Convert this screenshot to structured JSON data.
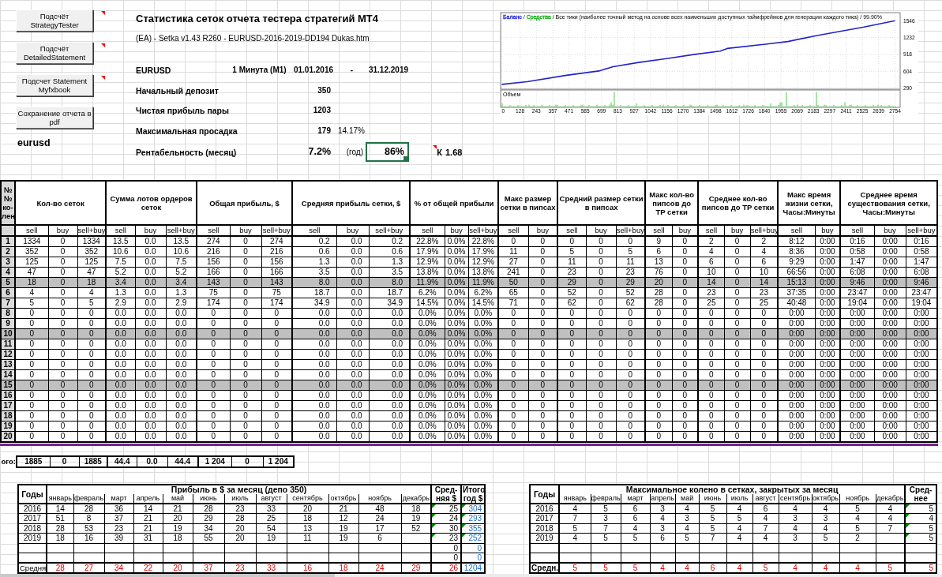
{
  "toolbar_buttons": [
    {
      "label": "Подсчёт StrategyTester",
      "has_comment": true
    },
    {
      "label": "Подсчёт DetailedStatement",
      "has_comment": true
    },
    {
      "label": "Подсчет Statement Myfxbook",
      "has_comment": true
    },
    {
      "label": "Сохранение отчета в pdf",
      "has_comment": false
    }
  ],
  "pair_cell": "eurusd",
  "report": {
    "title": "Статистика сеток отчета тестера стратегий МТ4",
    "file": "(EA) - Setka v1.43 R260 - EURUSD-2016-2019-DD194 Dukas.htm",
    "symbol": "EURUSD",
    "timeframe": "1 Минута (M1)",
    "date_from": "01.01.2016",
    "date_separator": "-",
    "date_to": "31.12.2019",
    "metrics": [
      {
        "label": "Начальный депозит",
        "value": "350"
      },
      {
        "label": "Чистая прибыль пары",
        "value": "1203"
      },
      {
        "label": "Максимальная просадка",
        "value": "179",
        "extra": "14.17%"
      }
    ],
    "profitability": {
      "label": "Рентабельность (месяц)",
      "value": "7.2%",
      "year_label": "(год)",
      "year_value": "86%",
      "year_selected": true,
      "ratio_label": "К",
      "ratio_comment": true,
      "ratio_value": "1.68"
    }
  },
  "chart": {
    "header": [
      {
        "text": "Баланс",
        "color": "#3535e0"
      },
      {
        "text": "/"
      },
      {
        "text": "Средства",
        "color": "#22b022"
      },
      {
        "text": "/ Все тики (наиболее точный метод на основе всех наименьших доступных таймфреймов для генерации каждого тика) / 99.90%"
      }
    ],
    "volume_label": "Объем",
    "chart_data": {
      "type": "line",
      "x": [
        0,
        178,
        454,
        681,
        780,
        958,
        1155,
        1352,
        1530,
        1579,
        1846,
        2004,
        2201,
        2537,
        2754
      ],
      "series": [
        {
          "color": "#2323c8",
          "values": [
            360,
            410,
            530,
            610,
            690,
            770,
            840,
            920,
            980,
            1030,
            1110,
            1160,
            1270,
            1430,
            1550
          ]
        }
      ],
      "xlim": [
        0,
        2790
      ],
      "ylim": [
        270,
        1700
      ],
      "xticks": [
        0,
        128,
        243,
        357,
        471,
        585,
        699,
        813,
        927,
        1042,
        1156,
        1270,
        1384,
        1498,
        1612,
        1726,
        1840,
        1955,
        2069,
        2183,
        2297,
        2411,
        2525,
        2639,
        2754
      ],
      "yticks": [
        290,
        604,
        918,
        1232,
        1546
      ],
      "grid": true
    }
  },
  "grid_table": {
    "corner": "№ № ко-лен",
    "groups": [
      {
        "title": "Кол-во сеток",
        "columns": [
          "sell",
          "buy",
          "sell+buy"
        ]
      },
      {
        "title": "Сумма лотов ордеров сеток",
        "columns": [
          "sell",
          "buy",
          "sell+buy"
        ]
      },
      {
        "title": "Общая прибыль, $",
        "columns": [
          "sell",
          "buy",
          "sell+buy"
        ]
      },
      {
        "title": "Средняя прибыль сетки, $",
        "columns": [
          "sell",
          "buy",
          "sell+buy"
        ]
      },
      {
        "title": "% от общей прибыли",
        "columns": [
          "sell",
          "buy",
          "sell+buy"
        ]
      },
      {
        "title": "Макс размер сетки в пипсах",
        "columns": [
          "sell",
          "buy"
        ]
      },
      {
        "title": "Средний размер сетки в пипсах",
        "columns": [
          "sell",
          "buy",
          "sell+buy"
        ]
      },
      {
        "title": "Макс кол-во пипсов до TP сетки",
        "columns": [
          "sell",
          "buy"
        ]
      },
      {
        "title": "Среднее кол-во пипсов до TP сетки",
        "columns": [
          "sell",
          "buy",
          "sell+buy"
        ]
      },
      {
        "title": "Макс время жизни сетки, Часы:Минуты",
        "columns": [
          "sell",
          "buy"
        ]
      },
      {
        "title": "Среднее время существования сетки, Часы:Минуты",
        "columns": [
          "sell",
          "buy",
          "sell+buy"
        ]
      }
    ],
    "rows": [
      {
        "number": "1",
        "shaded": false,
        "cells": [
          "1334",
          "0",
          "1334",
          "13.5",
          "0.0",
          "13.5",
          "274",
          "0",
          "274",
          "0.2",
          "0.0",
          "0.2",
          "22.8%",
          "0.0%",
          "22.8%",
          "0",
          "0",
          "0",
          "0",
          "0",
          "9",
          "0",
          "2",
          "0",
          "2",
          "8:12",
          "0:00",
          "0:16",
          "0:00",
          "0:16"
        ]
      },
      {
        "number": "2",
        "shaded": false,
        "cells": [
          "352",
          "0",
          "352",
          "10.6",
          "0.0",
          "10.6",
          "216",
          "0",
          "216",
          "0.6",
          "0.0",
          "0.6",
          "17.9%",
          "0.0%",
          "17.9%",
          "11",
          "0",
          "5",
          "0",
          "5",
          "6",
          "0",
          "4",
          "0",
          "4",
          "8:36",
          "0:00",
          "0:58",
          "0:00",
          "0:58"
        ]
      },
      {
        "number": "3",
        "shaded": false,
        "cells": [
          "125",
          "0",
          "125",
          "7.5",
          "0.0",
          "7.5",
          "156",
          "0",
          "156",
          "1.3",
          "0.0",
          "1.3",
          "12.9%",
          "0.0%",
          "12.9%",
          "27",
          "0",
          "11",
          "0",
          "11",
          "13",
          "0",
          "6",
          "0",
          "6",
          "9:29",
          "0:00",
          "1:47",
          "0:00",
          "1:47"
        ]
      },
      {
        "number": "4",
        "shaded": false,
        "cells": [
          "47",
          "0",
          "47",
          "5.2",
          "0.0",
          "5.2",
          "166",
          "0",
          "166",
          "3.5",
          "0.0",
          "3.5",
          "13.8%",
          "0.0%",
          "13.8%",
          "241",
          "0",
          "23",
          "0",
          "23",
          "76",
          "0",
          "10",
          "0",
          "10",
          "66:56",
          "0:00",
          "6:08",
          "0:00",
          "6:08"
        ]
      },
      {
        "number": "5",
        "shaded": true,
        "cells": [
          "18",
          "0",
          "18",
          "3.4",
          "0.0",
          "3.4",
          "143",
          "0",
          "143",
          "8.0",
          "0.0",
          "8.0",
          "11.9%",
          "0.0%",
          "11.9%",
          "50",
          "0",
          "29",
          "0",
          "29",
          "20",
          "0",
          "14",
          "0",
          "14",
          "15:13",
          "0:00",
          "9:46",
          "0:00",
          "9:46"
        ]
      },
      {
        "number": "6",
        "shaded": false,
        "cells": [
          "4",
          "0",
          "4",
          "1.3",
          "0.0",
          "1.3",
          "75",
          "0",
          "75",
          "18.7",
          "0.0",
          "18.7",
          "6.2%",
          "0.0%",
          "6.2%",
          "65",
          "0",
          "52",
          "0",
          "52",
          "28",
          "0",
          "23",
          "0",
          "23",
          "37:35",
          "0:00",
          "23:47",
          "0:00",
          "23:47"
        ]
      },
      {
        "number": "7",
        "shaded": false,
        "cells": [
          "5",
          "0",
          "5",
          "2.9",
          "0.0",
          "2.9",
          "174",
          "0",
          "174",
          "34.9",
          "0.0",
          "34.9",
          "14.5%",
          "0.0%",
          "14.5%",
          "71",
          "0",
          "62",
          "0",
          "62",
          "28",
          "0",
          "25",
          "0",
          "25",
          "40:48",
          "0:00",
          "19:04",
          "0:00",
          "19:04"
        ]
      },
      {
        "number": "8",
        "shaded": false,
        "cells": [
          "0",
          "0",
          "0",
          "0.0",
          "0.0",
          "0.0",
          "0",
          "0",
          "0",
          "0.0",
          "0.0",
          "0.0",
          "0.0%",
          "0.0%",
          "0.0%",
          "0",
          "0",
          "0",
          "0",
          "0",
          "0",
          "0",
          "0",
          "0",
          "0",
          "0:00",
          "0:00",
          "0:00",
          "0:00",
          "0:00"
        ]
      },
      {
        "number": "9",
        "shaded": false,
        "cells": [
          "0",
          "0",
          "0",
          "0.0",
          "0.0",
          "0.0",
          "0",
          "0",
          "0",
          "0.0",
          "0.0",
          "0.0",
          "0.0%",
          "0.0%",
          "0.0%",
          "0",
          "0",
          "0",
          "0",
          "0",
          "0",
          "0",
          "0",
          "0",
          "0",
          "0:00",
          "0:00",
          "0:00",
          "0:00",
          "0:00"
        ]
      },
      {
        "number": "10",
        "shaded": true,
        "cells": [
          "0",
          "0",
          "0",
          "0.0",
          "0.0",
          "0.0",
          "0",
          "0",
          "0",
          "0.0",
          "0.0",
          "0.0",
          "0.0%",
          "0.0%",
          "0.0%",
          "0",
          "0",
          "0",
          "0",
          "0",
          "0",
          "0",
          "0",
          "0",
          "0",
          "0:00",
          "0:00",
          "0:00",
          "0:00",
          "0:00"
        ]
      },
      {
        "number": "11",
        "shaded": false,
        "cells": [
          "0",
          "0",
          "0",
          "0.0",
          "0.0",
          "0.0",
          "0",
          "0",
          "0",
          "0.0",
          "0.0",
          "0.0",
          "0.0%",
          "0.0%",
          "0.0%",
          "0",
          "0",
          "0",
          "0",
          "0",
          "0",
          "0",
          "0",
          "0",
          "0",
          "0:00",
          "0:00",
          "0:00",
          "0:00",
          "0:00"
        ]
      },
      {
        "number": "12",
        "shaded": false,
        "cells": [
          "0",
          "0",
          "0",
          "0.0",
          "0.0",
          "0.0",
          "0",
          "0",
          "0",
          "0.0",
          "0.0",
          "0.0",
          "0.0%",
          "0.0%",
          "0.0%",
          "0",
          "0",
          "0",
          "0",
          "0",
          "0",
          "0",
          "0",
          "0",
          "0",
          "0:00",
          "0:00",
          "0:00",
          "0:00",
          "0:00"
        ]
      },
      {
        "number": "13",
        "shaded": false,
        "cells": [
          "0",
          "0",
          "0",
          "0.0",
          "0.0",
          "0.0",
          "0",
          "0",
          "0",
          "0.0",
          "0.0",
          "0.0",
          "0.0%",
          "0.0%",
          "0.0%",
          "0",
          "0",
          "0",
          "0",
          "0",
          "0",
          "0",
          "0",
          "0",
          "0",
          "0:00",
          "0:00",
          "0:00",
          "0:00",
          "0:00"
        ]
      },
      {
        "number": "14",
        "shaded": false,
        "cells": [
          "0",
          "0",
          "0",
          "0.0",
          "0.0",
          "0.0",
          "0",
          "0",
          "0",
          "0.0",
          "0.0",
          "0.0",
          "0.0%",
          "0.0%",
          "0.0%",
          "0",
          "0",
          "0",
          "0",
          "0",
          "0",
          "0",
          "0",
          "0",
          "0",
          "0:00",
          "0:00",
          "0:00",
          "0:00",
          "0:00"
        ]
      },
      {
        "number": "15",
        "shaded": true,
        "cells": [
          "0",
          "0",
          "0",
          "0.0",
          "0.0",
          "0.0",
          "0",
          "0",
          "0",
          "0.0",
          "0.0",
          "0.0",
          "0.0%",
          "0.0%",
          "0.0%",
          "0",
          "0",
          "0",
          "0",
          "0",
          "0",
          "0",
          "0",
          "0",
          "0",
          "0:00",
          "0:00",
          "0:00",
          "0:00",
          "0:00"
        ]
      },
      {
        "number": "16",
        "shaded": false,
        "cells": [
          "0",
          "0",
          "0",
          "0.0",
          "0.0",
          "0.0",
          "0",
          "0",
          "0",
          "0.0",
          "0.0",
          "0.0",
          "0.0%",
          "0.0%",
          "0.0%",
          "0",
          "0",
          "0",
          "0",
          "0",
          "0",
          "0",
          "0",
          "0",
          "0",
          "0:00",
          "0:00",
          "0:00",
          "0:00",
          "0:00"
        ]
      },
      {
        "number": "17",
        "shaded": false,
        "cells": [
          "0",
          "0",
          "0",
          "0.0",
          "0.0",
          "0.0",
          "0",
          "0",
          "0",
          "0.0",
          "0.0",
          "0.0",
          "0.0%",
          "0.0%",
          "0.0%",
          "0",
          "0",
          "0",
          "0",
          "0",
          "0",
          "0",
          "0",
          "0",
          "0",
          "0:00",
          "0:00",
          "0:00",
          "0:00",
          "0:00"
        ]
      },
      {
        "number": "18",
        "shaded": false,
        "cells": [
          "0",
          "0",
          "0",
          "0.0",
          "0.0",
          "0.0",
          "0",
          "0",
          "0",
          "0.0",
          "0.0",
          "0.0",
          "0.0%",
          "0.0%",
          "0.0%",
          "0",
          "0",
          "0",
          "0",
          "0",
          "0",
          "0",
          "0",
          "0",
          "0",
          "0:00",
          "0:00",
          "0:00",
          "0:00",
          "0:00"
        ]
      },
      {
        "number": "19",
        "shaded": false,
        "cells": [
          "0",
          "0",
          "0",
          "0.0",
          "0.0",
          "0.0",
          "0",
          "0",
          "0",
          "0.0",
          "0.0",
          "0.0",
          "0.0%",
          "0.0%",
          "0.0%",
          "0",
          "0",
          "0",
          "0",
          "0",
          "0",
          "0",
          "0",
          "0",
          "0",
          "0:00",
          "0:00",
          "0:00",
          "0:00",
          "0:00"
        ]
      },
      {
        "number": "20",
        "shaded": false,
        "cells": [
          "0",
          "0",
          "0",
          "0.0",
          "0.0",
          "0.0",
          "0",
          "0",
          "0",
          "0.0",
          "0.0",
          "0.0",
          "0.0%",
          "0.0%",
          "0.0%",
          "0",
          "0",
          "0",
          "0",
          "0",
          "0",
          "0",
          "0",
          "0",
          "0",
          "0:00",
          "0:00",
          "0:00",
          "0:00",
          "0:00"
        ]
      }
    ]
  },
  "totals": {
    "label": "ого:",
    "cells": [
      "1885",
      "0",
      "1885",
      "44.4",
      "0.0",
      "44.4",
      "1 204",
      "0",
      "1 204"
    ]
  },
  "monthly_profit": {
    "years_header": "Годы",
    "title": "Прибыль в $ за месяц (депо 350)",
    "average_header": "Сред-няя $",
    "total_header": "Итого год $",
    "months": [
      "январь",
      "февраль",
      "март",
      "апрель",
      "май",
      "июнь",
      "июль",
      "август",
      "сентябрь",
      "октябрь",
      "ноябрь",
      "декабрь"
    ],
    "rows": [
      {
        "year": "2016",
        "values": [
          "14",
          "28",
          "36",
          "14",
          "21",
          "28",
          "23",
          "33",
          "20",
          "21",
          "48",
          "18"
        ],
        "average": "25",
        "total": "304",
        "flagged": true
      },
      {
        "year": "2017",
        "values": [
          "51",
          "8",
          "37",
          "21",
          "20",
          "29",
          "28",
          "25",
          "18",
          "12",
          "24",
          "19"
        ],
        "average": "24",
        "total": "293",
        "flagged": true
      },
      {
        "year": "2018",
        "values": [
          "28",
          "53",
          "23",
          "21",
          "19",
          "34",
          "20",
          "54",
          "13",
          "19",
          "17",
          "52"
        ],
        "average": "30",
        "total": "355",
        "flagged": true
      },
      {
        "year": "2019",
        "values": [
          "18",
          "16",
          "39",
          "31",
          "18",
          "55",
          "20",
          "19",
          "11",
          "19",
          "6"
        ],
        "average": "23",
        "total": "252",
        "flagged": true
      },
      {
        "average": "0",
        "total": "0",
        "flagged": false
      },
      {
        "average": "0",
        "total": "0",
        "flagged": false
      }
    ],
    "footer": {
      "label": "Средня",
      "values": [
        "28",
        "27",
        "34",
        "22",
        "20",
        "37",
        "23",
        "33",
        "16",
        "18",
        "24",
        "29"
      ],
      "average": "26",
      "total": "1204"
    }
  },
  "max_knee": {
    "years_header": "Годы",
    "title": "Максимальное колено в сетках, закрытых за месяц",
    "average_header": "Сред-нее",
    "months": [
      "январь",
      "февраль",
      "март",
      "апрель",
      "май",
      "июнь",
      "июль",
      "август",
      "сентябрь",
      "октябрь",
      "ноябрь",
      "декабрь"
    ],
    "rows": [
      {
        "year": "2016",
        "values": [
          "4",
          "5",
          "6",
          "3",
          "4",
          "5",
          "4",
          "6",
          "4",
          "4",
          "5",
          "4"
        ],
        "average": "5",
        "flagged": true
      },
      {
        "year": "2017",
        "values": [
          "7",
          "3",
          "6",
          "4",
          "3",
          "5",
          "5",
          "4",
          "3",
          "3",
          "4",
          "4"
        ],
        "average": "4",
        "flagged": true
      },
      {
        "year": "2018",
        "values": [
          "5",
          "7",
          "4",
          "3",
          "4",
          "5",
          "4",
          "7",
          "4",
          "4",
          "5",
          "7"
        ],
        "average": "5",
        "flagged": true
      },
      {
        "year": "2019",
        "values": [
          "4",
          "5",
          "5",
          "6",
          "5",
          "7",
          "4",
          "4",
          "3",
          "5",
          "2"
        ],
        "average": "5",
        "flagged": true
      },
      {
        "flagged": false
      },
      {
        "flagged": false
      }
    ],
    "footer": {
      "label": "Средн.",
      "values": [
        "5",
        "5",
        "5",
        "4",
        "4",
        "6",
        "4",
        "5",
        "4",
        "4",
        "4",
        "5"
      ],
      "average": "5"
    }
  }
}
